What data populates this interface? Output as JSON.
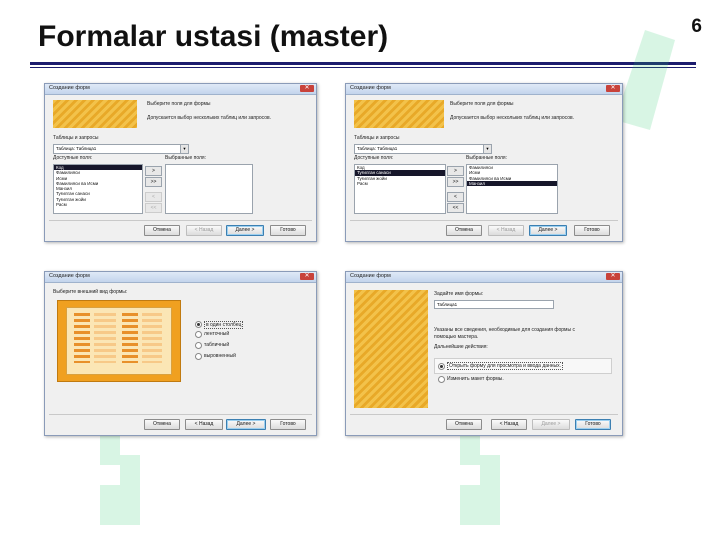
{
  "slide": {
    "title": "Formalar ustasi (master)",
    "page_number": "6"
  },
  "win1": {
    "window_title": "Создание форм",
    "heading": "Выберите поля для формы",
    "hint": "Допускается выбор нескольких таблиц или запросов.",
    "tables_label": "Таблицы и запросы",
    "combo_value": "Таблица: Таблица1",
    "available_label": "Доступные поля:",
    "selected_label": "Выбранные поля:",
    "available_fields": [
      "Код",
      "Фамилияси",
      "Исми",
      "Фамилияси ва Исми",
      "Манзил",
      "Туғилган санаси",
      "Туғилган жойи",
      "Расм"
    ],
    "selected_fields": [],
    "move_buttons": [
      ">",
      ">>",
      "<",
      "<<"
    ],
    "buttons": {
      "cancel": "Отмена",
      "back": "< Назад",
      "next": "Далее >",
      "finish": "Готово"
    }
  },
  "win2": {
    "window_title": "Создание форм",
    "heading": "Выберите поля для формы",
    "hint": "Допускается выбор нескольких таблиц или запросов.",
    "tables_label": "Таблицы и запросы",
    "combo_value": "Таблица: Таблица1",
    "available_label": "Доступные поля:",
    "selected_label": "Выбранные поля:",
    "available_fields": [
      "Код",
      "Туғилган санаси",
      "Туғилган жойи",
      "Расм"
    ],
    "selected_fields": [
      "Фамилияси",
      "Исми",
      "Фамилияси ва Исми",
      "Манзил"
    ],
    "move_buttons": [
      ">",
      ">>",
      "<",
      "<<"
    ],
    "buttons": {
      "cancel": "Отмена",
      "back": "< Назад",
      "next": "Далее >",
      "finish": "Готово"
    }
  },
  "win3": {
    "window_title": "Создание форм",
    "heading": "Выберите внешний вид формы:",
    "options": [
      "в один столбец",
      "ленточный",
      "табличный",
      "выровненный"
    ],
    "selected_option": 0,
    "buttons": {
      "cancel": "Отмена",
      "back": "< Назад",
      "next": "Далее >",
      "finish": "Готово"
    }
  },
  "win4": {
    "window_title": "Создание форм",
    "name_prompt": "Задайте имя формы:",
    "form_name": "Таблица1",
    "info_line1": "Указаны все сведения, необходимые для создания формы с",
    "info_line2": "помощью мастера.",
    "next_action_label": "Дальнейшие действия:",
    "options": [
      "Открыть форму для просмотра и ввода данных.",
      "Изменить макет формы."
    ],
    "selected_option": 0,
    "buttons": {
      "cancel": "Отмена",
      "back": "< Назад",
      "next": "Далее >",
      "finish": "Готово"
    }
  },
  "colors": {
    "title_rule": "#1c1c6e",
    "preview_yellow": "#f3c24a",
    "selection": "#16162a"
  }
}
